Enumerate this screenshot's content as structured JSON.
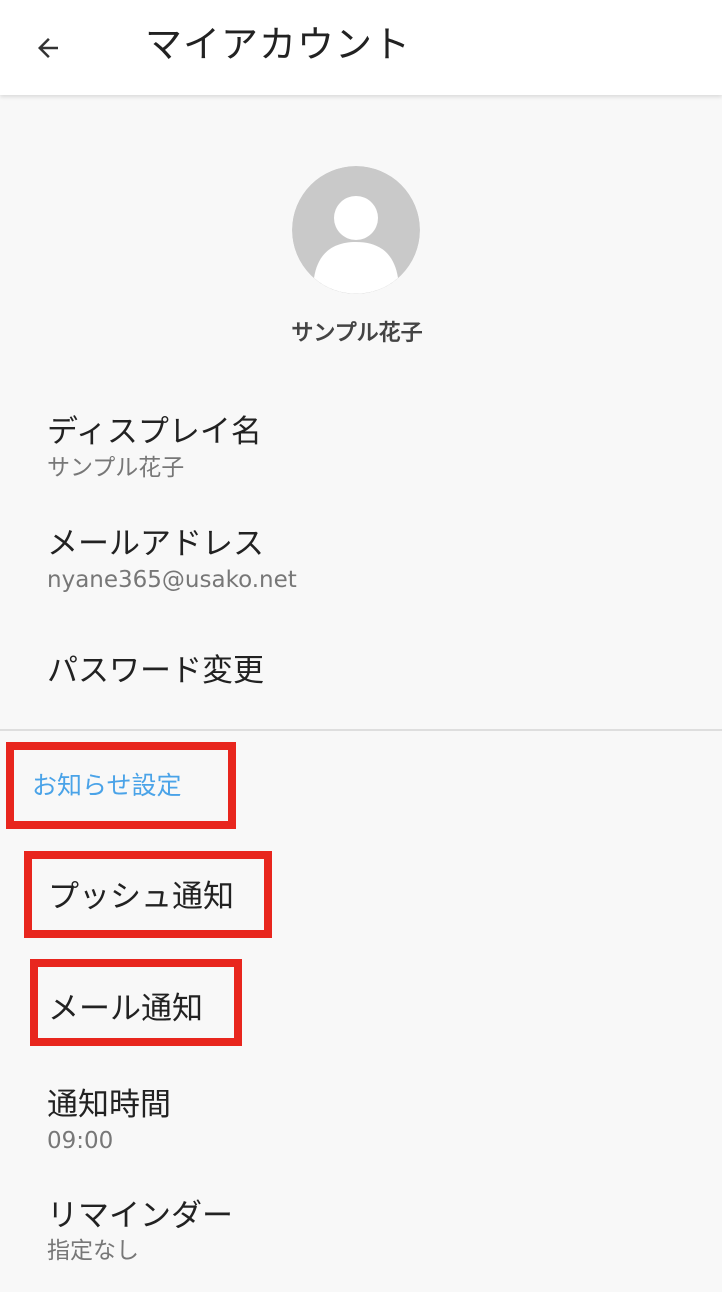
{
  "appbar": {
    "title": "マイアカウント",
    "back_icon": "arrow-left-icon"
  },
  "profile": {
    "avatar_icon": "default-avatar-icon",
    "name": "サンプル花子"
  },
  "account_items": {
    "display_name": {
      "title": "ディスプレイ名",
      "value": "サンプル花子"
    },
    "email": {
      "title": "メールアドレス",
      "value": "nyane365@usako.net"
    },
    "password": {
      "title": "パスワード変更"
    }
  },
  "notification_section": {
    "header": "お知らせ設定",
    "push": {
      "title": "プッシュ通知"
    },
    "mail": {
      "title": "メール通知"
    },
    "time": {
      "title": "通知時間",
      "value": "09:00"
    },
    "reminder": {
      "title": "リマインダー",
      "value": "指定なし"
    }
  },
  "colors": {
    "accent": "#4aa3e8",
    "highlight": "#e8261e",
    "background": "#f8f8f8",
    "avatar": "#c9c9c9"
  }
}
